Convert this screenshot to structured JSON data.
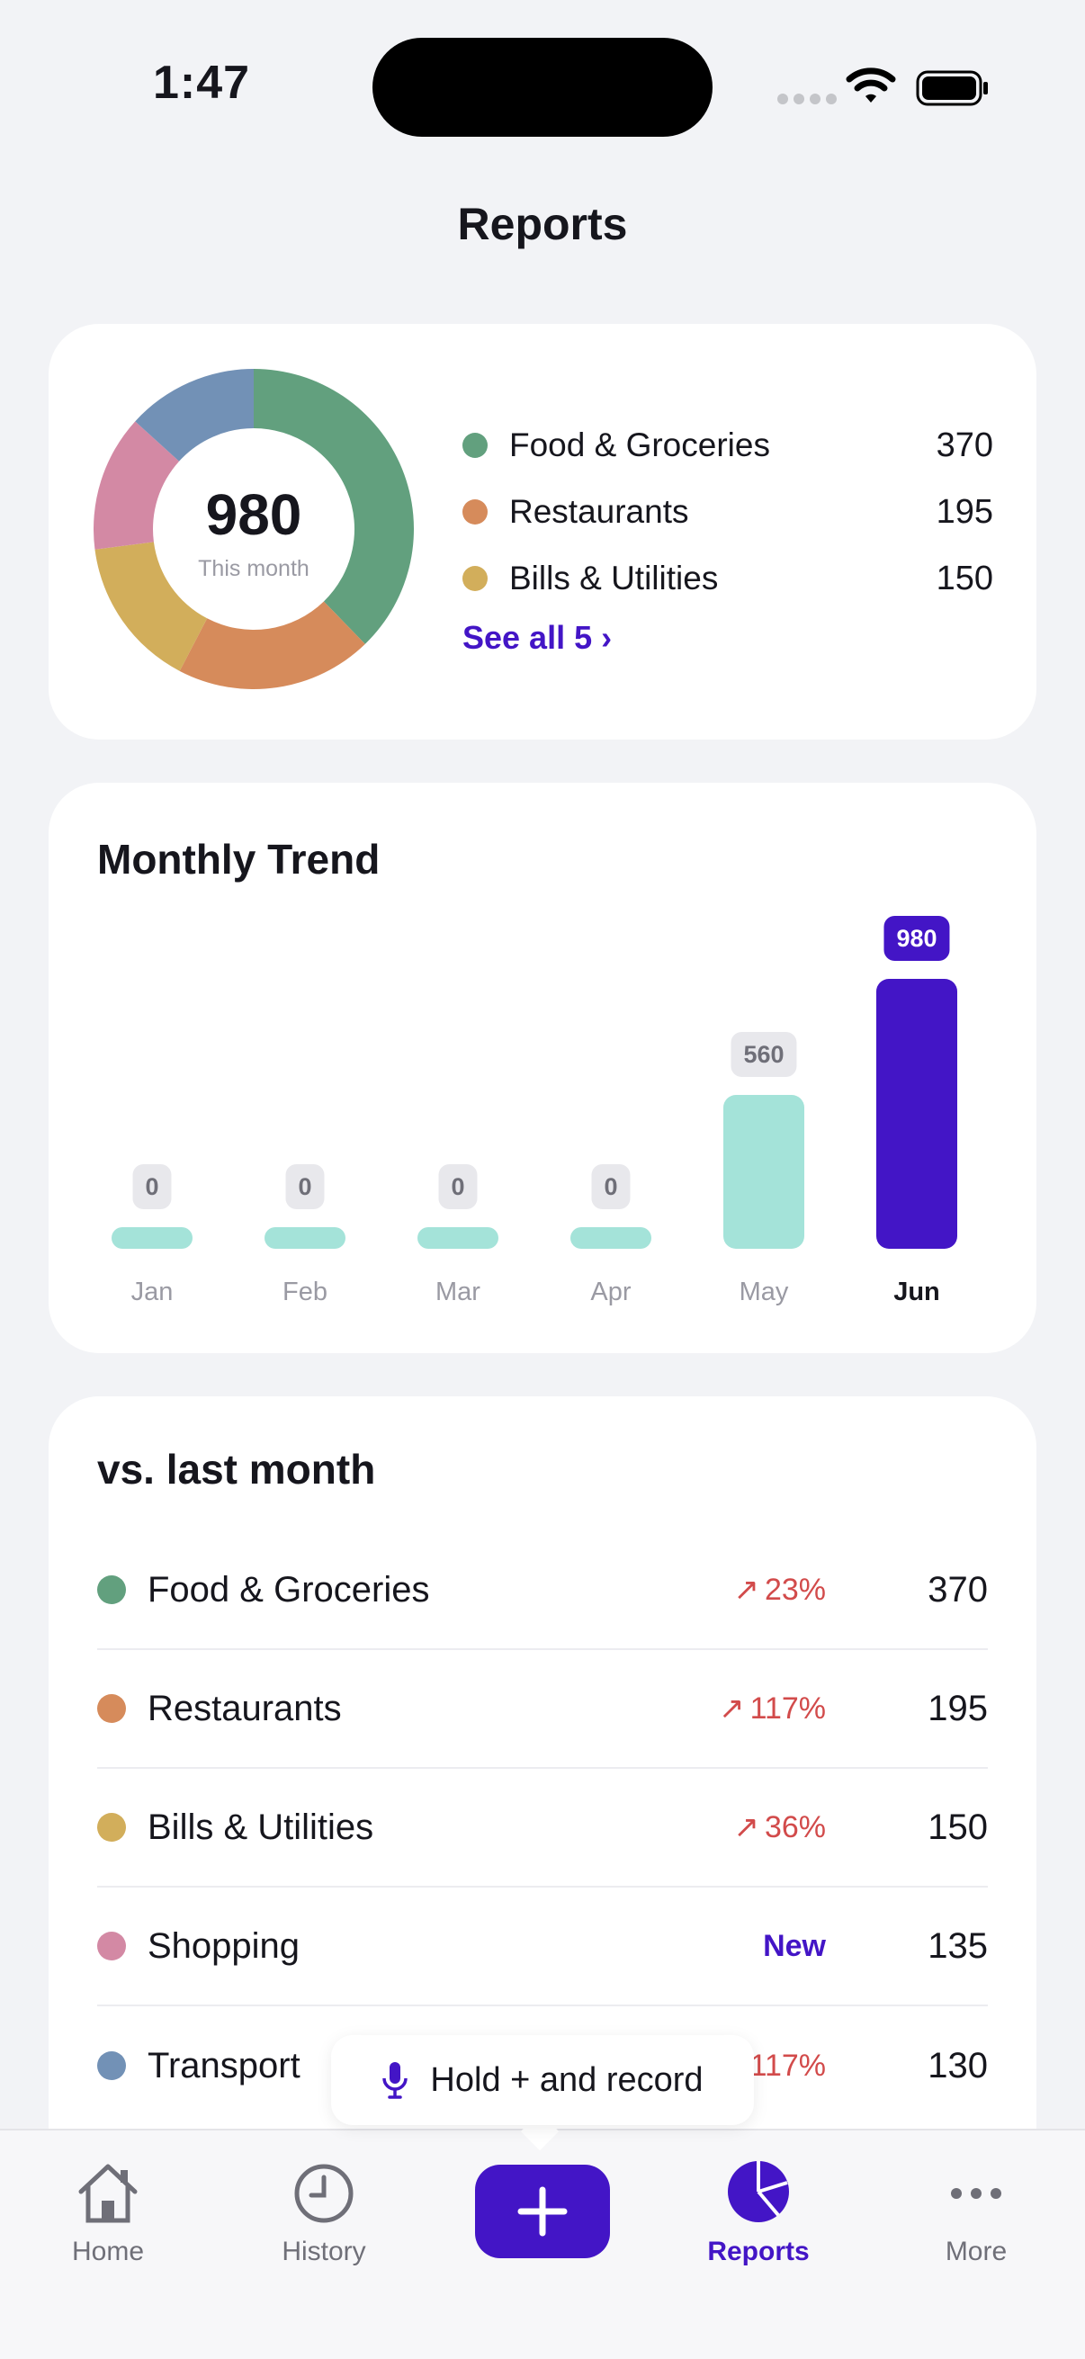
{
  "status": {
    "time": "1:47"
  },
  "page": {
    "title": "Reports"
  },
  "summary": {
    "total": "980",
    "subtitle": "This month",
    "see_all": "See all 5 ›",
    "slices": [
      {
        "name": "Food & Groceries",
        "value": 370,
        "color": "#62a07e"
      },
      {
        "name": "Restaurants",
        "value": 195,
        "color": "#d68b5b"
      },
      {
        "name": "Bills & Utilities",
        "value": 150,
        "color": "#d2ae5b"
      },
      {
        "name": "Shopping",
        "value": 135,
        "color": "#d389a4"
      },
      {
        "name": "Transport",
        "value": 130,
        "color": "#7291b6"
      }
    ],
    "legend": [
      {
        "label": "Food & Groceries",
        "value": "370"
      },
      {
        "label": "Restaurants",
        "value": "195"
      },
      {
        "label": "Bills & Utilities",
        "value": "150"
      }
    ]
  },
  "chart_data": {
    "type": "bar",
    "title": "Monthly Trend",
    "categories": [
      "Jan",
      "Feb",
      "Mar",
      "Apr",
      "May",
      "Jun"
    ],
    "values": [
      0,
      0,
      0,
      0,
      560,
      980
    ],
    "highlighted": "Jun",
    "colors": {
      "bar": "#a4e3d9",
      "highlight": "#4315c6"
    }
  },
  "trend": {
    "title": "Monthly Trend",
    "labels": [
      "Jan",
      "Feb",
      "Mar",
      "Apr",
      "May",
      "Jun"
    ],
    "badges": [
      "0",
      "0",
      "0",
      "0",
      "560",
      "980"
    ]
  },
  "comparison": {
    "title": "vs. last month",
    "rows": [
      {
        "label": "Food & Groceries",
        "change": "23%",
        "value": "370",
        "color": "#62a07e"
      },
      {
        "label": "Restaurants",
        "change": "117%",
        "value": "195",
        "color": "#d68b5b"
      },
      {
        "label": "Bills & Utilities",
        "change": "36%",
        "value": "150",
        "color": "#d2ae5b"
      },
      {
        "label": "Shopping",
        "change": "New",
        "value": "135",
        "color": "#d389a4"
      },
      {
        "label": "Transport",
        "change": "117%",
        "value": "130",
        "color": "#7291b6"
      }
    ]
  },
  "tooltip": {
    "text": "Hold + and record"
  },
  "tabs": [
    {
      "label": "Home",
      "icon": "home-icon"
    },
    {
      "label": "History",
      "icon": "clock-icon"
    },
    {
      "label": "Reports",
      "icon": "pie-chart-icon"
    },
    {
      "label": "More",
      "icon": "more-icon"
    }
  ],
  "colors": {
    "accent": "#4315c6",
    "increase": "#d24b4b"
  }
}
